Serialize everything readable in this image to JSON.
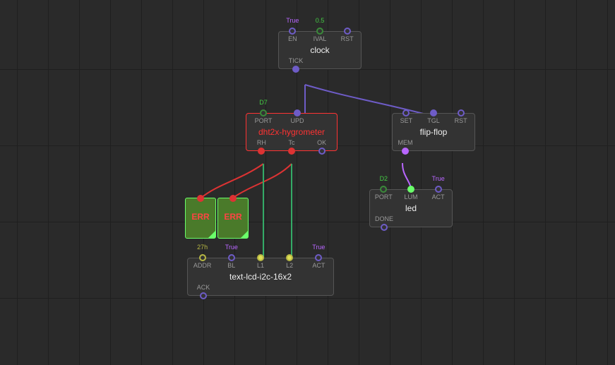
{
  "nodes": {
    "clock": {
      "title": "clock",
      "inputs": {
        "en": {
          "label": "EN",
          "value": "True"
        },
        "ival": {
          "label": "IVAL",
          "value": "0.5"
        },
        "rst": {
          "label": "RST"
        }
      },
      "outputs": {
        "tick": {
          "label": "TICK"
        }
      }
    },
    "dht": {
      "title": "dht2x-hygrometer",
      "inputs": {
        "port": {
          "label": "PORT",
          "value": "D7"
        },
        "upd": {
          "label": "UPD"
        }
      },
      "outputs": {
        "rh": {
          "label": "RH"
        },
        "tc": {
          "label": "Tc"
        },
        "ok": {
          "label": "OK"
        }
      }
    },
    "flipflop": {
      "title": "flip-flop",
      "inputs": {
        "set": {
          "label": "SET"
        },
        "tgl": {
          "label": "TGL"
        },
        "rst": {
          "label": "RST"
        }
      },
      "outputs": {
        "mem": {
          "label": "MEM"
        }
      }
    },
    "led": {
      "title": "led",
      "inputs": {
        "port": {
          "label": "PORT",
          "value": "D2"
        },
        "lum": {
          "label": "LUM"
        },
        "act": {
          "label": "ACT",
          "value": "True"
        }
      },
      "outputs": {
        "done": {
          "label": "DONE"
        }
      }
    },
    "lcd": {
      "title": "text-lcd-i2c-16x2",
      "inputs": {
        "addr": {
          "label": "ADDR",
          "value": "27h"
        },
        "bl": {
          "label": "BL",
          "value": "True"
        },
        "l1": {
          "label": "L1"
        },
        "l2": {
          "label": "L2"
        },
        "act": {
          "label": "ACT",
          "value": "True"
        }
      },
      "outputs": {
        "ack": {
          "label": "ACK"
        }
      }
    }
  },
  "errBadge": {
    "label": "ERR"
  }
}
